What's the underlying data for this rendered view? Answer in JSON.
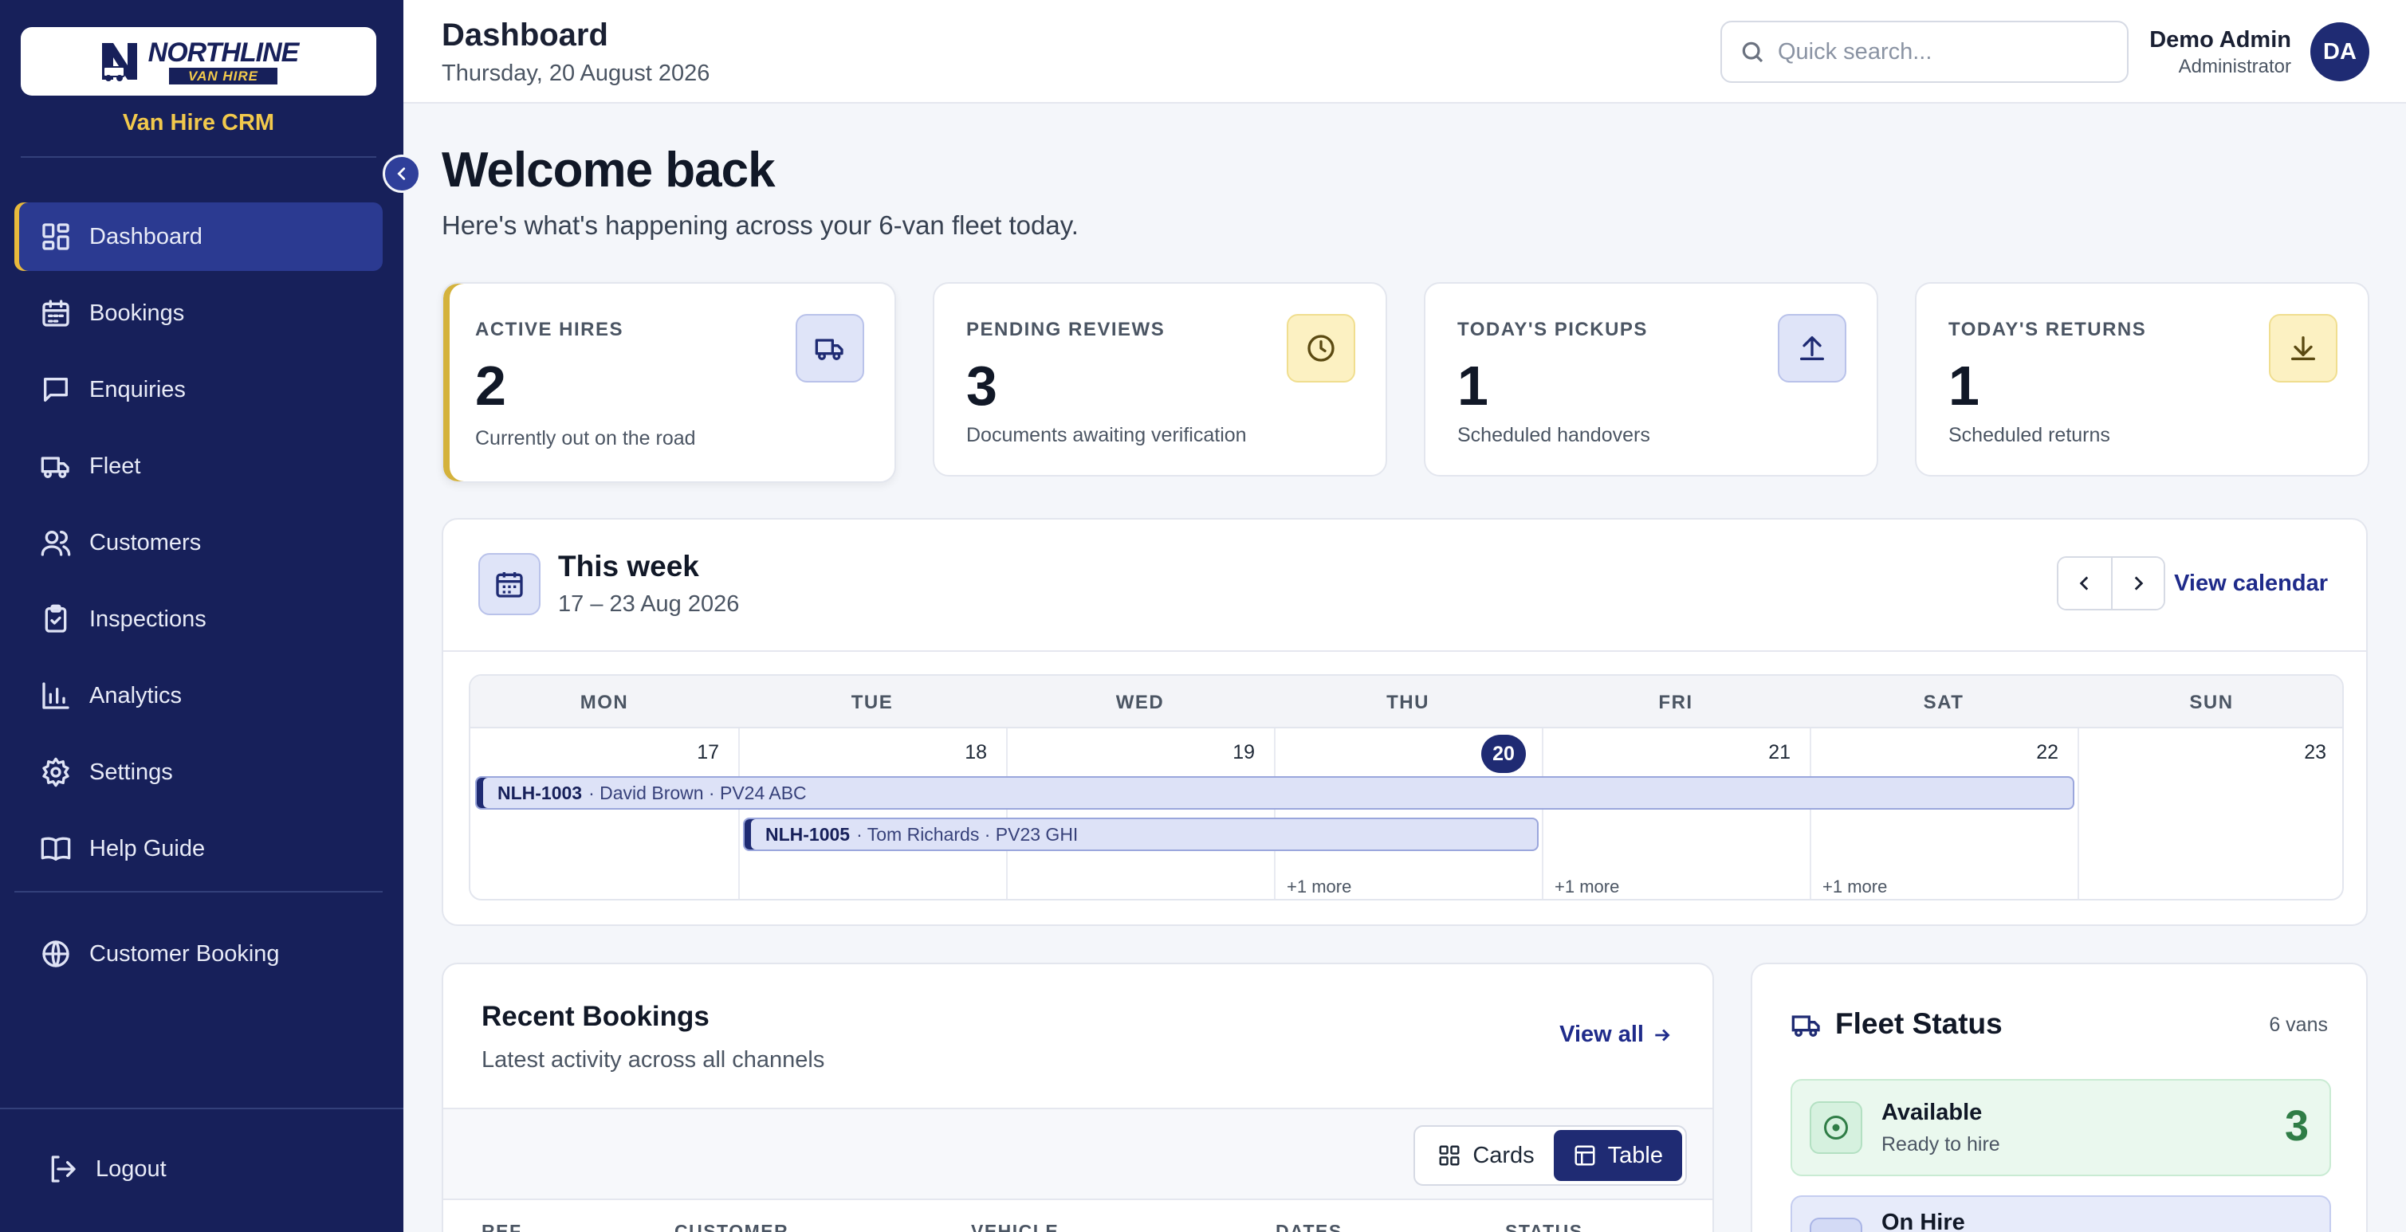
{
  "brand": {
    "logo_top": "NORTHLINE",
    "logo_bottom": "VAN HIRE",
    "subtitle": "Van Hire CRM"
  },
  "sidebar": {
    "items": [
      {
        "label": "Dashboard",
        "icon": "dashboard-icon",
        "active": true
      },
      {
        "label": "Bookings",
        "icon": "calendar-icon"
      },
      {
        "label": "Enquiries",
        "icon": "chat-icon"
      },
      {
        "label": "Fleet",
        "icon": "truck-icon"
      },
      {
        "label": "Customers",
        "icon": "users-icon"
      },
      {
        "label": "Inspections",
        "icon": "clipboard-check-icon"
      },
      {
        "label": "Analytics",
        "icon": "bar-chart-icon"
      },
      {
        "label": "Settings",
        "icon": "gear-icon"
      },
      {
        "label": "Help Guide",
        "icon": "book-icon"
      }
    ],
    "extra_item": {
      "label": "Customer Booking",
      "icon": "globe-icon"
    },
    "logout_label": "Logout"
  },
  "header": {
    "title": "Dashboard",
    "date": "Thursday, 20 August 2026",
    "search_placeholder": "Quick search...",
    "user_name": "Demo Admin",
    "user_role": "Administrator",
    "avatar_initials": "DA"
  },
  "welcome": {
    "title": "Welcome back",
    "subtitle": "Here's what's happening across your 6-van fleet today."
  },
  "stats": [
    {
      "label": "ACTIVE HIRES",
      "value": "2",
      "desc": "Currently out on the road",
      "icon": "truck-icon"
    },
    {
      "label": "PENDING REVIEWS",
      "value": "3",
      "desc": "Documents awaiting verification",
      "icon": "clock-icon"
    },
    {
      "label": "TODAY'S PICKUPS",
      "value": "1",
      "desc": "Scheduled handovers",
      "icon": "upload-icon"
    },
    {
      "label": "TODAY'S RETURNS",
      "value": "1",
      "desc": "Scheduled returns",
      "icon": "download-icon"
    }
  ],
  "week": {
    "title": "This week",
    "range": "17 – 23 Aug 2026",
    "view_calendar": "View calendar",
    "days": [
      {
        "dow": "MON",
        "date": "17"
      },
      {
        "dow": "TUE",
        "date": "18"
      },
      {
        "dow": "WED",
        "date": "19"
      },
      {
        "dow": "THU",
        "date": "20",
        "today": true
      },
      {
        "dow": "FRI",
        "date": "21"
      },
      {
        "dow": "SAT",
        "date": "22"
      },
      {
        "dow": "SUN",
        "date": "23"
      }
    ],
    "bookings": [
      {
        "ref": "NLH-1003",
        "detail": "· David Brown · PV24 ABC"
      },
      {
        "ref": "NLH-1005",
        "detail": "· Tom Richards · PV23 GHI"
      }
    ],
    "more_label": "+1 more"
  },
  "recent_bookings": {
    "title": "Recent Bookings",
    "subtitle": "Latest activity across all channels",
    "view_all": "View all",
    "toggle_cards": "Cards",
    "toggle_table": "Table",
    "columns": [
      "REF",
      "CUSTOMER",
      "VEHICLE",
      "DATES",
      "STATUS"
    ]
  },
  "fleet_status": {
    "title": "Fleet Status",
    "count": "6 vans",
    "rows": [
      {
        "label": "Available",
        "sub": "Ready to hire",
        "value": "3"
      },
      {
        "label": "On Hire",
        "sub": "",
        "value": ""
      }
    ]
  },
  "colors": {
    "sidebar_bg": "#17205a",
    "accent": "#1f2b73",
    "brand_yellow": "#f2c94c",
    "available_green": "#2f7d46"
  }
}
